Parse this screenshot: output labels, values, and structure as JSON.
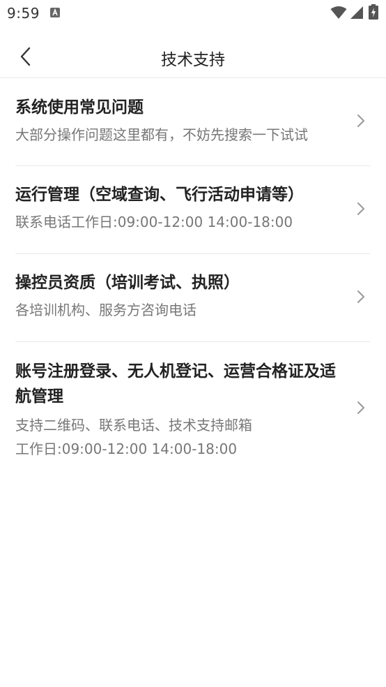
{
  "status_bar": {
    "time": "9:59",
    "notification_icon": "a-notification-icon",
    "wifi_icon": "wifi-icon",
    "signal_icon": "cell-signal-icon",
    "battery_icon": "battery-charging-icon"
  },
  "header": {
    "title": "技术支持",
    "back_icon": "chevron-left-icon"
  },
  "items": [
    {
      "title": "系统使用常见问题",
      "lines": [
        "大部分操作问题这里都有，不妨先搜索一下试试"
      ]
    },
    {
      "title": "运行管理（空域查询、飞行活动申请等）",
      "lines": [
        "联系电话工作日:09:00-12:00 14:00-18:00"
      ]
    },
    {
      "title": "操控员资质（培训考试、执照）",
      "lines": [
        "各培训机构、服务方咨询电话"
      ]
    },
    {
      "title": "账号注册登录、无人机登记、运营合格证及适航管理",
      "lines": [
        "支持二维码、联系电话、技术支持邮箱",
        "工作日:09:00-12:00 14:00-18:00"
      ]
    }
  ],
  "colors": {
    "title_text": "#222222",
    "desc_text": "#777777",
    "divider": "#e9e9e9",
    "chevron": "#999999"
  }
}
